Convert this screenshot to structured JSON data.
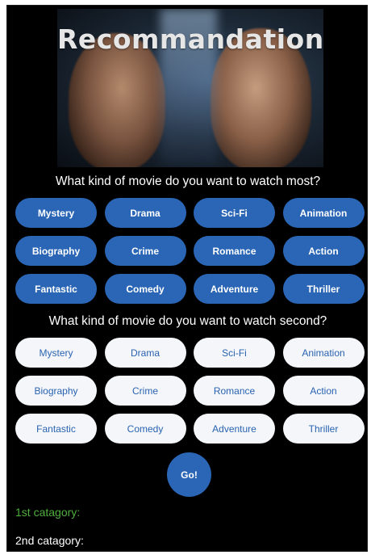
{
  "header": {
    "title": "Recommandation"
  },
  "colors": {
    "primary_button": "#2a66b5",
    "secondary_button": "#f4f6fa",
    "secondary_text": "#2a63b0",
    "first_result_text": "#4fae3d",
    "background": "#000000"
  },
  "first_choice": {
    "question": "What kind of movie do you want to watch most?",
    "genres": [
      "Mystery",
      "Drama",
      "Sci-Fi",
      "Animation",
      "Biography",
      "Crime",
      "Romance",
      "Action",
      "Fantastic",
      "Comedy",
      "Adventure",
      "Thriller"
    ]
  },
  "second_choice": {
    "question": "What kind of movie do you want to watch second?",
    "genres": [
      "Mystery",
      "Drama",
      "Sci-Fi",
      "Animation",
      "Biography",
      "Crime",
      "Romance",
      "Action",
      "Fantastic",
      "Comedy",
      "Adventure",
      "Thriller"
    ]
  },
  "go_button": {
    "label": "Go!"
  },
  "results": {
    "first_label": "1st catagory:",
    "second_label": "2nd catagory:"
  }
}
